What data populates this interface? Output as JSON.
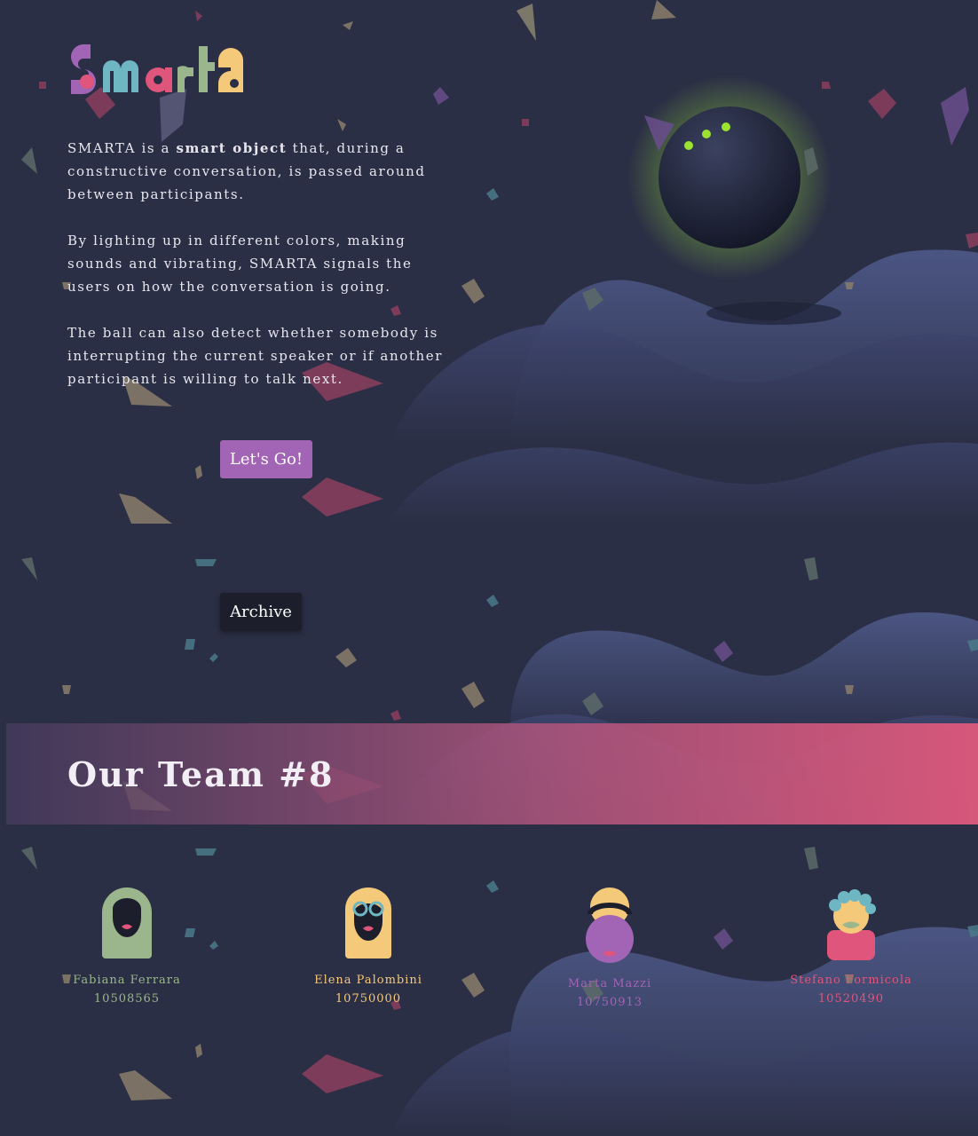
{
  "brand": {
    "name": "Smarta"
  },
  "intro": {
    "p1_a": "SMARTA is a ",
    "p1_bold": "smart object",
    "p1_b": " that, during a constructive conversation, is passed around between participants.",
    "p2": "By lighting up in different colors, making sounds and vibrating, SMARTA signals the users on how the conversation is going.",
    "p3": "The ball can also detect whether somebody is interrupting the current speaker or if another participant is willing to talk next."
  },
  "buttons": {
    "go_label": "Let's Go!",
    "archive_label": "Archive"
  },
  "team": {
    "title": "Our Team #8",
    "members": [
      {
        "name": "Fabiana Ferrara",
        "id": "10508565",
        "color": "#9bb68c"
      },
      {
        "name": "Elena Palombini",
        "id": "10750000",
        "color": "#f5c97a"
      },
      {
        "name": "Marta Mazzi",
        "id": "10750913",
        "color": "#a264b5"
      },
      {
        "name": "Stefano Formicola",
        "id": "10520490",
        "color": "#e0557b"
      }
    ]
  },
  "colors": {
    "background": "#2b2f45",
    "accent_purple": "#a264b5",
    "accent_pink": "#e0557b",
    "accent_teal": "#6fb6c3",
    "accent_yellow": "#f5c97a",
    "ball_glow": "#9be330"
  }
}
